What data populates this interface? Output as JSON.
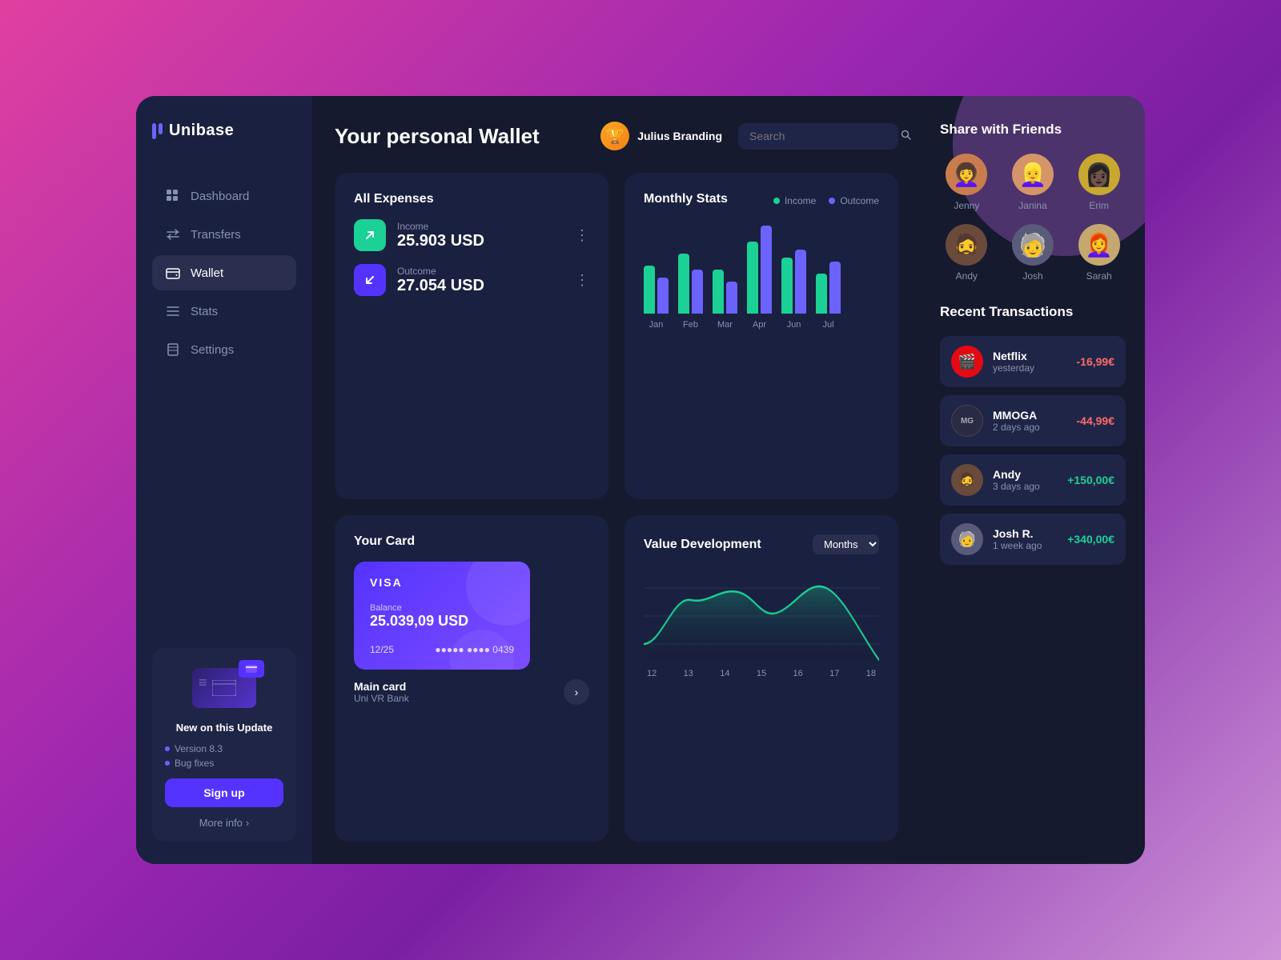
{
  "app": {
    "name": "Unibase"
  },
  "header": {
    "title": "Your personal Wallet",
    "user": {
      "name": "Julius Branding",
      "emoji": "🏆"
    },
    "search": {
      "placeholder": "Search"
    }
  },
  "sidebar": {
    "nav": [
      {
        "id": "dashboard",
        "label": "Dashboard",
        "icon": "⊞",
        "active": false
      },
      {
        "id": "transfers",
        "label": "Transfers",
        "icon": "⇄",
        "active": false
      },
      {
        "id": "wallet",
        "label": "Wallet",
        "icon": "▣",
        "active": true
      },
      {
        "id": "stats",
        "label": "Stats",
        "icon": "≡",
        "active": false
      },
      {
        "id": "settings",
        "label": "Settings",
        "icon": "🗑",
        "active": false
      }
    ],
    "promo": {
      "title": "New on this Update",
      "updates": [
        "Version 8.3",
        "Bug fixes"
      ],
      "cta": "Sign up",
      "more_info": "More info"
    }
  },
  "expenses": {
    "title": "All Expenses",
    "income": {
      "label": "Income",
      "amount": "25.903 USD"
    },
    "outcome": {
      "label": "Outcome",
      "amount": "27.054 USD"
    }
  },
  "monthly_stats": {
    "title": "Monthly Stats",
    "legend": {
      "income": "Income",
      "outcome": "Outcome"
    },
    "bars": [
      {
        "month": "Jan",
        "income": 60,
        "outcome": 45
      },
      {
        "month": "Feb",
        "income": 75,
        "outcome": 55
      },
      {
        "month": "Mar",
        "income": 55,
        "outcome": 40
      },
      {
        "month": "Apr",
        "income": 90,
        "outcome": 105
      },
      {
        "month": "Jun",
        "income": 70,
        "outcome": 80
      },
      {
        "month": "Jul",
        "income": 50,
        "outcome": 65
      }
    ]
  },
  "card": {
    "title": "Your Card",
    "brand": "VISA",
    "balance_label": "Balance",
    "balance": "25.039,09 USD",
    "expiry": "12/25",
    "number_masked": "●●●●● ●●●● 0439",
    "card_name": "Main card",
    "bank": "Uni VR Bank"
  },
  "value_dev": {
    "title": "Value Development",
    "dropdown_label": "Months",
    "x_labels": [
      "12",
      "13",
      "14",
      "15",
      "16",
      "17",
      "18"
    ],
    "curve": [
      20,
      70,
      55,
      80,
      50,
      85,
      30,
      10
    ]
  },
  "friends": {
    "title": "Share with Friends",
    "list": [
      {
        "name": "Jenny",
        "emoji": "👩‍🦱",
        "bg": "#c97d4e"
      },
      {
        "name": "Janina",
        "emoji": "👱‍♀️",
        "bg": "#d4956a"
      },
      {
        "name": "Erim",
        "emoji": "👩🏿‍🦱",
        "bg": "#c8a830"
      },
      {
        "name": "Andy",
        "emoji": "🧔",
        "bg": "#6a4a3a"
      },
      {
        "name": "Josh",
        "emoji": "🧓",
        "bg": "#5a5a7a"
      },
      {
        "name": "Sarah",
        "emoji": "👩‍🦰",
        "bg": "#c4a870"
      }
    ]
  },
  "transactions": {
    "title": "Recent Transactions",
    "list": [
      {
        "name": "Netflix",
        "date": "yesterday",
        "amount": "-16,99€",
        "type": "negative",
        "icon": "🎬",
        "bg": "#e50914"
      },
      {
        "name": "MMOGA",
        "date": "2 days ago",
        "amount": "-44,99€",
        "type": "negative",
        "icon": "🎮",
        "bg": "#2a2a40"
      },
      {
        "name": "Andy",
        "date": "3 days ago",
        "amount": "+150,00€",
        "type": "positive",
        "icon": "🧔",
        "bg": "#6a4a3a"
      },
      {
        "name": "Josh R.",
        "date": "1 week ago",
        "amount": "+340,00€",
        "type": "positive",
        "icon": "🧓",
        "bg": "#5a5a7a"
      }
    ]
  }
}
